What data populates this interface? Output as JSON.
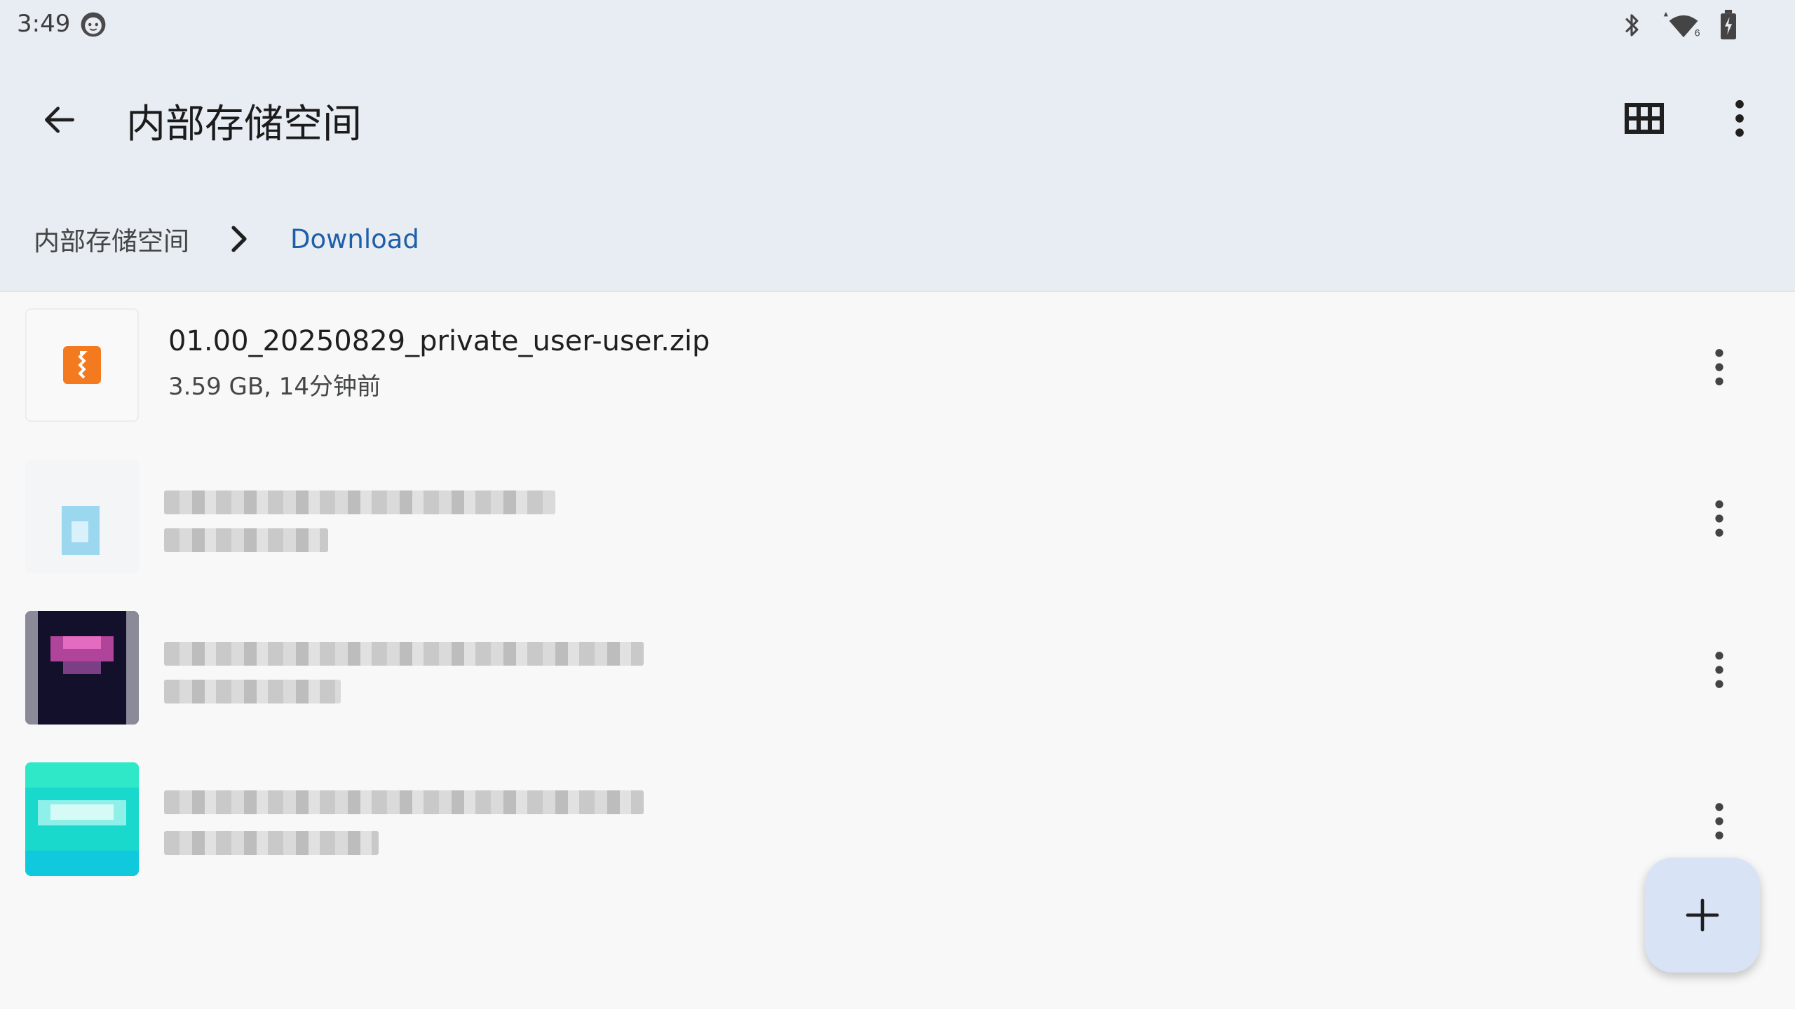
{
  "status_bar": {
    "time": "3:49",
    "icons": [
      "face-icon",
      "bluetooth-icon",
      "wifi-icon",
      "battery-charging-icon"
    ],
    "wifi_label": "6"
  },
  "app_bar": {
    "title": "内部存储空间",
    "back_icon": "arrow-left-icon",
    "view_icon": "grid-view-icon",
    "more_icon": "more-vert-icon"
  },
  "breadcrumb": {
    "root": "内部存储空间",
    "current": "Download"
  },
  "files": [
    {
      "name": "01.00_20250829_private_user-user.zip",
      "meta": "3.59 GB, 14分钟前",
      "icon": "zip-file-icon"
    },
    {
      "name": "",
      "meta": "",
      "icon": "blurred-file-icon"
    },
    {
      "name": "",
      "meta": "",
      "icon": "blurred-image-thumb"
    },
    {
      "name": "",
      "meta": "",
      "icon": "blurred-image-thumb"
    }
  ],
  "fab": {
    "icon": "plus-icon"
  },
  "colors": {
    "header_bg": "#e8ecf3",
    "accent": "#1f5fa8",
    "zip_orange": "#f47a20",
    "fab_bg": "#d9e3f6"
  }
}
